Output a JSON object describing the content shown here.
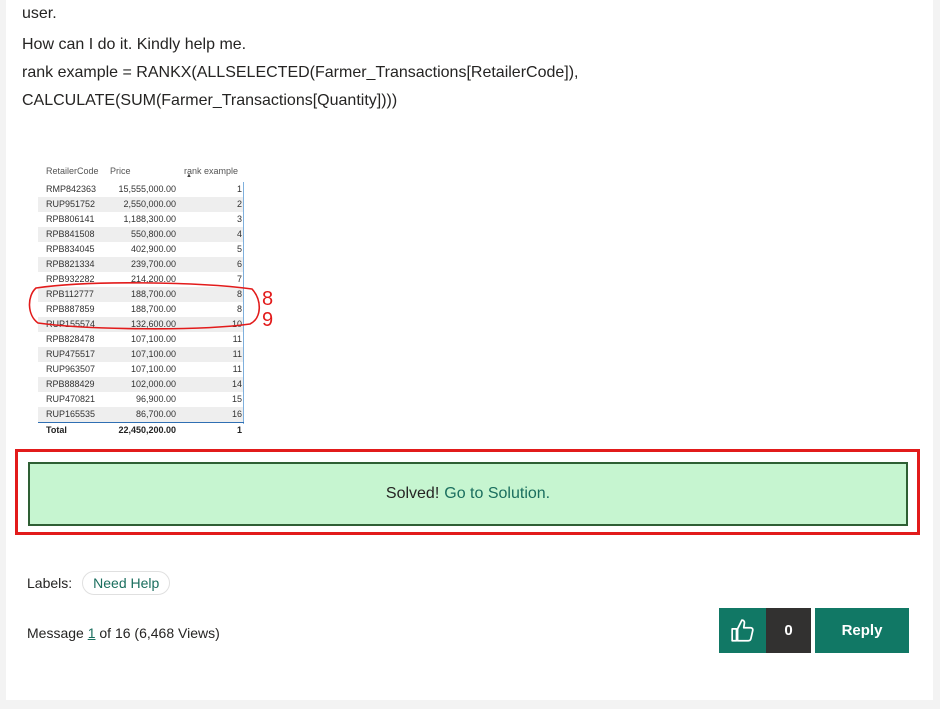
{
  "post": {
    "lines": [
      "user.",
      "How can I do it. Kindly help me.",
      "rank example = RANKX(ALLSELECTED(Farmer_Transactions[RetailerCode]),",
      "CALCULATE(SUM(Farmer_Transactions[Quantity])))"
    ]
  },
  "table": {
    "headers": [
      "RetailerCode",
      "Price",
      "rank example"
    ],
    "rows": [
      [
        "RMP842363",
        "15,555,000.00",
        "1"
      ],
      [
        "RUP951752",
        "2,550,000.00",
        "2"
      ],
      [
        "RPB806141",
        "1,188,300.00",
        "3"
      ],
      [
        "RPB841508",
        "550,800.00",
        "4"
      ],
      [
        "RPB834045",
        "402,900.00",
        "5"
      ],
      [
        "RPB821334",
        "239,700.00",
        "6"
      ],
      [
        "RPB932282",
        "214,200.00",
        "7"
      ],
      [
        "RPB112777",
        "188,700.00",
        "8"
      ],
      [
        "RPB887859",
        "188,700.00",
        "8"
      ],
      [
        "RUP155574",
        "132,600.00",
        "10"
      ],
      [
        "RPB828478",
        "107,100.00",
        "11"
      ],
      [
        "RUP475517",
        "107,100.00",
        "11"
      ],
      [
        "RUP963507",
        "107,100.00",
        "11"
      ],
      [
        "RPB888429",
        "102,000.00",
        "14"
      ],
      [
        "RUP470821",
        "96,900.00",
        "15"
      ],
      [
        "RUP165535",
        "86,700.00",
        "16"
      ]
    ],
    "total": [
      "Total",
      "22,450,200.00",
      "1"
    ],
    "annotation_marks": [
      "8",
      "9"
    ]
  },
  "solved": {
    "text": "Solved!",
    "link": "Go to Solution."
  },
  "labels": {
    "title": "Labels:",
    "chip": "Need Help"
  },
  "message": {
    "prefix": "Message",
    "number": "1",
    "suffix": "of 16  (6,468 Views)"
  },
  "actions": {
    "kudos_icon": "thumbs-up-icon",
    "kudos_count": "0",
    "reply": "Reply"
  },
  "colors": {
    "accent": "#117865",
    "solved_bg": "#c6f5d0",
    "highlight_red": "#e21b1b"
  }
}
